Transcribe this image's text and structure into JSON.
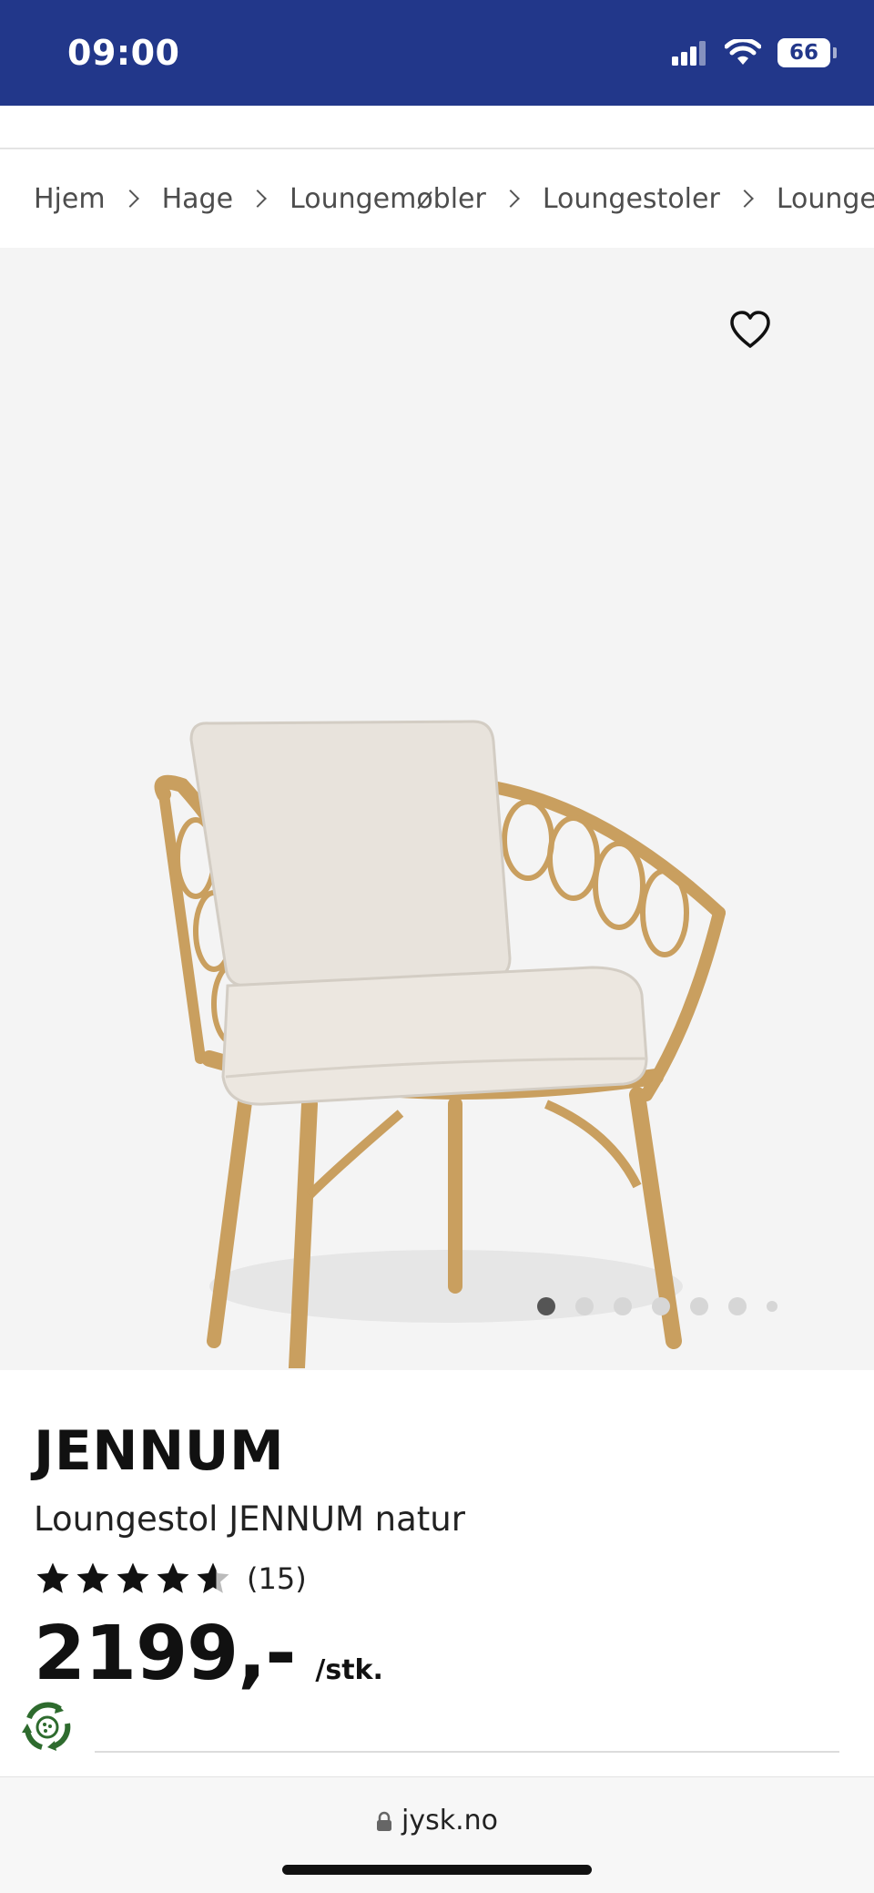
{
  "status_bar": {
    "time": "09:00",
    "battery": "66",
    "icons": [
      "signal-icon",
      "wifi-icon",
      "battery-icon"
    ]
  },
  "breadcrumb": [
    "Hjem",
    "Hage",
    "Loungemøbler",
    "Loungestoler",
    "Loungestol"
  ],
  "gallery": {
    "favorite_icon": "heart-icon",
    "image_alt": "Loungestol JENNUM natur",
    "slide_count": 7,
    "active_slide": 1
  },
  "product": {
    "brand": "JENNUM",
    "name": "Loungestol JENNUM natur",
    "rating": 4.5,
    "review_count": "(15)",
    "price": "2199,-",
    "unit": "/stk."
  },
  "browser": {
    "url": "jysk.no",
    "lock_icon": "lock-icon"
  },
  "colors": {
    "header_blue": "#22378a",
    "gallery_bg": "#f4f4f4",
    "recycle_green": "#2e6b2e"
  }
}
